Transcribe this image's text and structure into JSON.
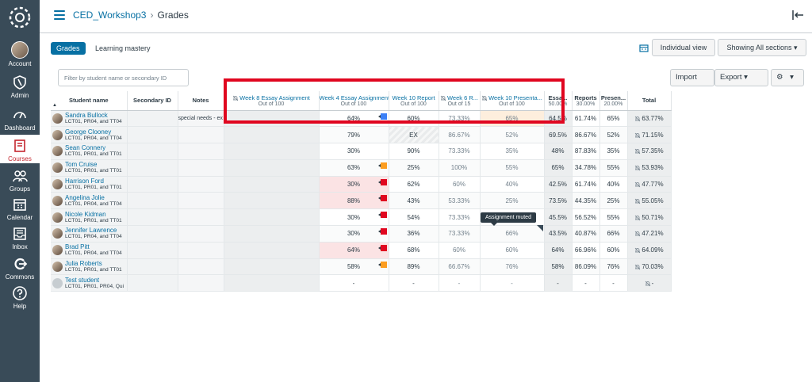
{
  "nav": {
    "account": "Account",
    "admin": "Admin",
    "dashboard": "Dashboard",
    "courses": "Courses",
    "groups": "Groups",
    "calendar": "Calendar",
    "inbox": "Inbox",
    "commons": "Commons",
    "help": "Help"
  },
  "breadcrumb": {
    "course": "CED_Workshop3",
    "separator": "›",
    "page": "Grades"
  },
  "tabs": {
    "grades": "Grades",
    "mastery": "Learning mastery"
  },
  "toolbar": {
    "individual_view": "Individual view",
    "sections": "Showing All sections ▾",
    "filter_placeholder": "Filter by student name or secondary ID",
    "import": "Import",
    "export": "Export ▾",
    "settings": "▾"
  },
  "columns": {
    "student": "Student name",
    "secondary": "Secondary ID",
    "notes": "Notes",
    "w8": {
      "title": "Week 8 Essay Assignment",
      "sub": "Out of 100"
    },
    "w4": {
      "title": "Week 4 Essay Assignment",
      "sub": "Out of 100"
    },
    "w10r": {
      "title": "Week 10 Report",
      "sub": "Out of 100"
    },
    "w6r": {
      "title": "Week 6 R...",
      "sub": "Out of 15"
    },
    "w10p": {
      "title": "Week 10 Presenta...",
      "sub": "Out of 100"
    },
    "essays": {
      "title": "Essa...",
      "sub": "50.00%"
    },
    "reports": {
      "title": "Reports",
      "sub": "30.00%"
    },
    "presen": {
      "title": "Presen...",
      "sub": "20.00%"
    },
    "total": "Total"
  },
  "rows": [
    {
      "name": "Sandra Bullock",
      "sections": "LCT01, PR04, and TT04",
      "notes": "special needs - ex",
      "w4": "64%",
      "w10r": "60%",
      "w6r": "73.33%",
      "w10p": "65%",
      "essays": "64.5%",
      "reports": "61.74%",
      "presen": "65%",
      "total": "63.77%"
    },
    {
      "name": "George Clooney",
      "sections": "LCT01, PR04, and TT04",
      "notes": "",
      "w4": "79%",
      "w10r": "EX",
      "w6r": "86.67%",
      "w10p": "52%",
      "essays": "69.5%",
      "reports": "86.67%",
      "presen": "52%",
      "total": "71.15%"
    },
    {
      "name": "Sean Connery",
      "sections": "LCT01, PR01, and TT01",
      "notes": "",
      "w4": "30%",
      "w10r": "90%",
      "w6r": "73.33%",
      "w10p": "35%",
      "essays": "48%",
      "reports": "87.83%",
      "presen": "35%",
      "total": "57.35%"
    },
    {
      "name": "Tom Cruise",
      "sections": "LCT01, PR01, and TT01",
      "notes": "",
      "w4": "63%",
      "w10r": "25%",
      "w6r": "100%",
      "w10p": "55%",
      "essays": "65%",
      "reports": "34.78%",
      "presen": "55%",
      "total": "53.93%"
    },
    {
      "name": "Harrison Ford",
      "sections": "LCT01, PR01, and TT01",
      "notes": "",
      "w4": "30%",
      "w10r": "62%",
      "w6r": "60%",
      "w10p": "40%",
      "essays": "42.5%",
      "reports": "61.74%",
      "presen": "40%",
      "total": "47.77%"
    },
    {
      "name": "Angelina Jolie",
      "sections": "LCT01, PR04, and TT04",
      "notes": "",
      "w4": "88%",
      "w10r": "43%",
      "w6r": "53.33%",
      "w10p": "25%",
      "essays": "73.5%",
      "reports": "44.35%",
      "presen": "25%",
      "total": "55.05%"
    },
    {
      "name": "Nicole Kidman",
      "sections": "LCT01, PR01, and TT01",
      "notes": "",
      "w4": "30%",
      "w10r": "54%",
      "w6r": "73.33%",
      "w10p": "",
      "essays": "45.5%",
      "reports": "56.52%",
      "presen": "55%",
      "total": "50.71%"
    },
    {
      "name": "Jennifer Lawrence",
      "sections": "LCT01, PR04, and TT04",
      "notes": "",
      "w4": "30%",
      "w10r": "36%",
      "w6r": "73.33%",
      "w10p": "66%",
      "essays": "43.5%",
      "reports": "40.87%",
      "presen": "66%",
      "total": "47.21%"
    },
    {
      "name": "Brad Pitt",
      "sections": "LCT01, PR04, and TT04",
      "notes": "",
      "w4": "64%",
      "w10r": "68%",
      "w6r": "60%",
      "w10p": "60%",
      "essays": "64%",
      "reports": "66.96%",
      "presen": "60%",
      "total": "64.09%"
    },
    {
      "name": "Julia Roberts",
      "sections": "LCT01, PR01, and TT01",
      "notes": "",
      "w4": "58%",
      "w10r": "89%",
      "w6r": "66.67%",
      "w10p": "76%",
      "essays": "58%",
      "reports": "86.09%",
      "presen": "76%",
      "total": "70.03%"
    },
    {
      "name": "Test student",
      "sections": "LCT01, PR01, PR04, Qui",
      "notes": "",
      "w4": "-",
      "w10r": "-",
      "w6r": "-",
      "w10p": "-",
      "essays": "-",
      "reports": "-",
      "presen": "-",
      "total": "-"
    }
  ],
  "tooltip": "Assignment muted",
  "colors": {
    "accent": "#0770a3",
    "nav_bg": "#394b58",
    "highlight": "#e0061f"
  }
}
